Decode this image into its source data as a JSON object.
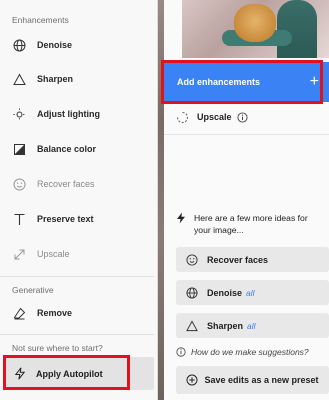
{
  "menu": {
    "enhancements_label": "Enhancements",
    "items": [
      {
        "label": "Denoise",
        "icon": "globe-icon",
        "enabled": true
      },
      {
        "label": "Sharpen",
        "icon": "triangle-icon",
        "enabled": true
      },
      {
        "label": "Adjust lighting",
        "icon": "sun-icon",
        "enabled": true
      },
      {
        "label": "Balance color",
        "icon": "balance-color-icon",
        "enabled": true
      },
      {
        "label": "Recover faces",
        "icon": "face-icon",
        "enabled": false
      },
      {
        "label": "Preserve text",
        "icon": "text-icon",
        "enabled": true
      },
      {
        "label": "Upscale",
        "icon": "expand-arrow-icon",
        "enabled": false
      }
    ],
    "generative_label": "Generative",
    "remove_label": "Remove",
    "start_label": "Not sure where to start?",
    "autopilot_label": "Apply Autopilot"
  },
  "panel": {
    "add_label": "Add enhancements",
    "upscale_label": "Upscale",
    "ideas_text": "Here are a few more ideas for your image...",
    "ideas": [
      {
        "label": "Recover faces",
        "extra": ""
      },
      {
        "label": "Denoise",
        "extra": "all"
      },
      {
        "label": "Sharpen",
        "extra": "all"
      }
    ],
    "how_text": "How do we make suggestions?",
    "save_label": "Save edits as a new preset"
  },
  "colors": {
    "accent": "#3b82f5",
    "highlight": "#e0121e"
  }
}
